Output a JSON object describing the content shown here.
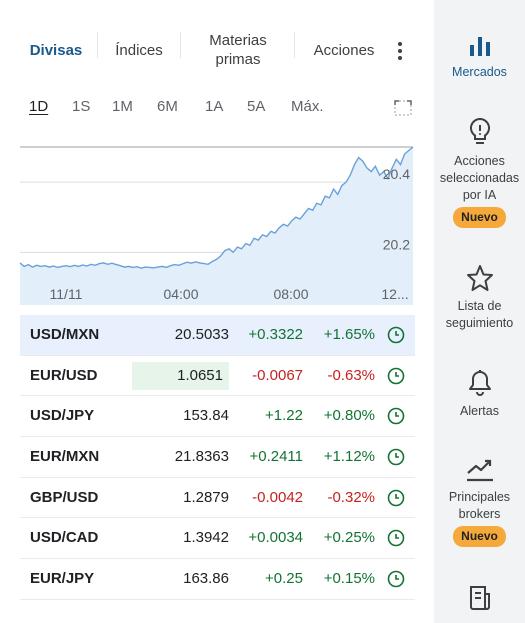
{
  "tabs": [
    {
      "label": "Divisas",
      "active": true
    },
    {
      "label": "Índices",
      "active": false
    },
    {
      "label": "Materias primas",
      "active": false
    },
    {
      "label": "Acciones",
      "active": false
    }
  ],
  "ranges": [
    {
      "label": "1D",
      "active": true
    },
    {
      "label": "1S",
      "active": false
    },
    {
      "label": "1M",
      "active": false
    },
    {
      "label": "6M",
      "active": false
    },
    {
      "label": "1A",
      "active": false
    },
    {
      "label": "5A",
      "active": false
    },
    {
      "label": "Máx.",
      "active": false
    }
  ],
  "chart_data": {
    "type": "area",
    "xtick_labels": [
      "11/11",
      "04:00",
      "08:00",
      "12..."
    ],
    "ytick_labels": [
      "20.4",
      "20.2"
    ],
    "ylim": [
      20.05,
      20.52
    ],
    "color": "#6aa1d8",
    "fill": "#e3eefb",
    "grid": "horizontal",
    "values": [
      20.17,
      20.16,
      20.165,
      20.158,
      20.163,
      20.16,
      20.162,
      20.158,
      20.161,
      20.157,
      20.16,
      20.162,
      20.159,
      20.163,
      20.16,
      20.164,
      20.161,
      20.166,
      20.163,
      20.168,
      20.17,
      20.166,
      20.169,
      20.165,
      20.162,
      20.158,
      20.16,
      20.157,
      20.159,
      20.155,
      20.158,
      20.157,
      20.156,
      20.158,
      20.16,
      20.157,
      20.162,
      20.165,
      20.163,
      20.168,
      20.172,
      20.169,
      20.173,
      20.17,
      20.168,
      20.166,
      20.174,
      20.18,
      20.19,
      20.205,
      20.21,
      20.2,
      20.215,
      20.21,
      20.225,
      20.22,
      20.24,
      20.235,
      20.25,
      20.245,
      20.26,
      20.255,
      20.27,
      20.28,
      20.275,
      20.29,
      20.3,
      20.295,
      20.31,
      20.325,
      20.32,
      20.34,
      20.335,
      20.36,
      20.355,
      20.38,
      20.365,
      20.39,
      20.4,
      20.42,
      20.45,
      20.47,
      20.46,
      20.44,
      20.43,
      20.445,
      20.42,
      20.43,
      20.41,
      20.44,
      20.465,
      20.45,
      20.48,
      20.49,
      20.5
    ]
  },
  "rates": [
    {
      "pair": "USD/MXN",
      "price": "20.5033",
      "change": "+0.3322",
      "pct": "+1.65%",
      "dir": "pos",
      "selected": true,
      "flash": false
    },
    {
      "pair": "EUR/USD",
      "price": "1.0651",
      "change": "-0.0067",
      "pct": "-0.63%",
      "dir": "neg",
      "selected": false,
      "flash": true
    },
    {
      "pair": "USD/JPY",
      "price": "153.84",
      "change": "+1.22",
      "pct": "+0.80%",
      "dir": "pos",
      "selected": false,
      "flash": false
    },
    {
      "pair": "EUR/MXN",
      "price": "21.8363",
      "change": "+0.2411",
      "pct": "+1.12%",
      "dir": "pos",
      "selected": false,
      "flash": false
    },
    {
      "pair": "GBP/USD",
      "price": "1.2879",
      "change": "-0.0042",
      "pct": "-0.32%",
      "dir": "neg",
      "selected": false,
      "flash": false
    },
    {
      "pair": "USD/CAD",
      "price": "1.3942",
      "change": "+0.0034",
      "pct": "+0.25%",
      "dir": "pos",
      "selected": false,
      "flash": false
    },
    {
      "pair": "EUR/JPY",
      "price": "163.86",
      "change": "+0.25",
      "pct": "+0.15%",
      "dir": "pos",
      "selected": false,
      "flash": false
    }
  ],
  "sidebar": {
    "mercados": "Mercados",
    "acciones_ia": "Acciones seleccionadas por IA",
    "acciones_ia_badge": "Nuevo",
    "lista": "Lista de seguimiento",
    "alertas": "Alertas",
    "brokers": "Principales brokers",
    "brokers_badge": "Nuevo"
  },
  "icons": {
    "more": "vertical-dots-icon",
    "expand": "expand-icon",
    "clock": "clock-icon",
    "mercados": "bar-chart-icon",
    "ia": "lightbulb-icon",
    "lista": "star-icon",
    "alertas": "bell-icon",
    "brokers": "trend-up-icon",
    "news": "newspaper-icon"
  },
  "colors": {
    "accent": "#1a5a8a",
    "positive": "#137333",
    "negative": "#c5221f",
    "badge": "#f6a93b",
    "selected_row": "#e8f0fe"
  }
}
